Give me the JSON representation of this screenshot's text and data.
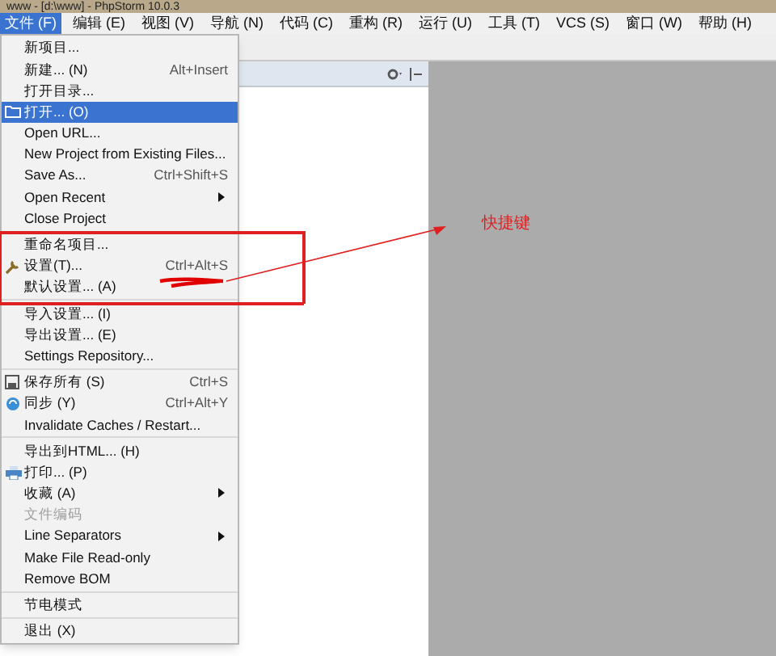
{
  "window": {
    "title": "www - [d:\\www] - PhpStorm 10.0.3"
  },
  "menubar": [
    {
      "label": "文件 (F)",
      "selected": true
    },
    {
      "label": "编辑 (E)",
      "selected": false
    },
    {
      "label": "视图 (V)",
      "selected": false
    },
    {
      "label": "导航 (N)",
      "selected": false
    },
    {
      "label": "代码 (C)",
      "selected": false
    },
    {
      "label": "重构 (R)",
      "selected": false
    },
    {
      "label": "运行 (U)",
      "selected": false
    },
    {
      "label": "工具 (T)",
      "selected": false
    },
    {
      "label": "VCS (S)",
      "selected": false
    },
    {
      "label": "窗口 (W)",
      "selected": false
    },
    {
      "label": "帮助 (H)",
      "selected": false
    }
  ],
  "file_menu": [
    {
      "kind": "item",
      "label": "新项目...",
      "selected": false,
      "disabled": false,
      "submenu": false
    },
    {
      "kind": "item",
      "label": "新建... (N)",
      "shortcut": "Alt+Insert",
      "selected": false,
      "disabled": false,
      "submenu": false
    },
    {
      "kind": "item",
      "label": "打开目录...",
      "selected": false,
      "disabled": false,
      "submenu": false
    },
    {
      "kind": "item",
      "label": "打开... (O)",
      "selected": true,
      "disabled": false,
      "submenu": false
    },
    {
      "kind": "item",
      "label": "Open URL...",
      "selected": false,
      "disabled": false,
      "submenu": false
    },
    {
      "kind": "item",
      "label": "New Project from Existing Files...",
      "selected": false,
      "disabled": false,
      "submenu": false
    },
    {
      "kind": "item",
      "label": "Save As...",
      "shortcut": "Ctrl+Shift+S",
      "selected": false,
      "disabled": false,
      "submenu": false
    },
    {
      "kind": "item",
      "label": "Open Recent",
      "selected": false,
      "disabled": false,
      "submenu": true
    },
    {
      "kind": "item",
      "label": "Close Project",
      "selected": false,
      "disabled": false,
      "submenu": false
    },
    {
      "kind": "separator"
    },
    {
      "kind": "item",
      "label": "重命名项目...",
      "selected": false,
      "disabled": false,
      "submenu": false
    },
    {
      "kind": "item",
      "label": "设置(T)...",
      "shortcut": "Ctrl+Alt+S",
      "selected": false,
      "disabled": false,
      "submenu": false
    },
    {
      "kind": "item",
      "label": "默认设置... (A)",
      "selected": false,
      "disabled": false,
      "submenu": false
    },
    {
      "kind": "separator"
    },
    {
      "kind": "item",
      "label": "导入设置... (I)",
      "selected": false,
      "disabled": false,
      "submenu": false
    },
    {
      "kind": "item",
      "label": "导出设置... (E)",
      "selected": false,
      "disabled": false,
      "submenu": false
    },
    {
      "kind": "item",
      "label": "Settings Repository...",
      "selected": false,
      "disabled": false,
      "submenu": false
    },
    {
      "kind": "separator"
    },
    {
      "kind": "item",
      "label": "保存所有 (S)",
      "shortcut": "Ctrl+S",
      "selected": false,
      "disabled": false,
      "submenu": false
    },
    {
      "kind": "item",
      "label": "同步 (Y)",
      "shortcut": "Ctrl+Alt+Y",
      "selected": false,
      "disabled": false,
      "submenu": false
    },
    {
      "kind": "item",
      "label": "Invalidate Caches / Restart...",
      "selected": false,
      "disabled": false,
      "submenu": false
    },
    {
      "kind": "separator"
    },
    {
      "kind": "item",
      "label": "导出到HTML... (H)",
      "selected": false,
      "disabled": false,
      "submenu": false
    },
    {
      "kind": "item",
      "label": "打印... (P)",
      "selected": false,
      "disabled": false,
      "submenu": false
    },
    {
      "kind": "item",
      "label": "收藏 (A)",
      "selected": false,
      "disabled": false,
      "submenu": true
    },
    {
      "kind": "item",
      "label": "文件编码",
      "selected": false,
      "disabled": true,
      "submenu": false
    },
    {
      "kind": "item",
      "label": "Line Separators",
      "selected": false,
      "disabled": false,
      "submenu": true
    },
    {
      "kind": "item",
      "label": "Make File Read-only",
      "selected": false,
      "disabled": false,
      "submenu": false
    },
    {
      "kind": "item",
      "label": "Remove BOM",
      "selected": false,
      "disabled": false,
      "submenu": false
    },
    {
      "kind": "separator"
    },
    {
      "kind": "item",
      "label": "节电模式",
      "selected": false,
      "disabled": false,
      "submenu": false
    },
    {
      "kind": "separator"
    },
    {
      "kind": "item",
      "label": "退出 (X)",
      "selected": false,
      "disabled": false,
      "submenu": false
    }
  ],
  "annotation": {
    "label": "快捷键"
  }
}
